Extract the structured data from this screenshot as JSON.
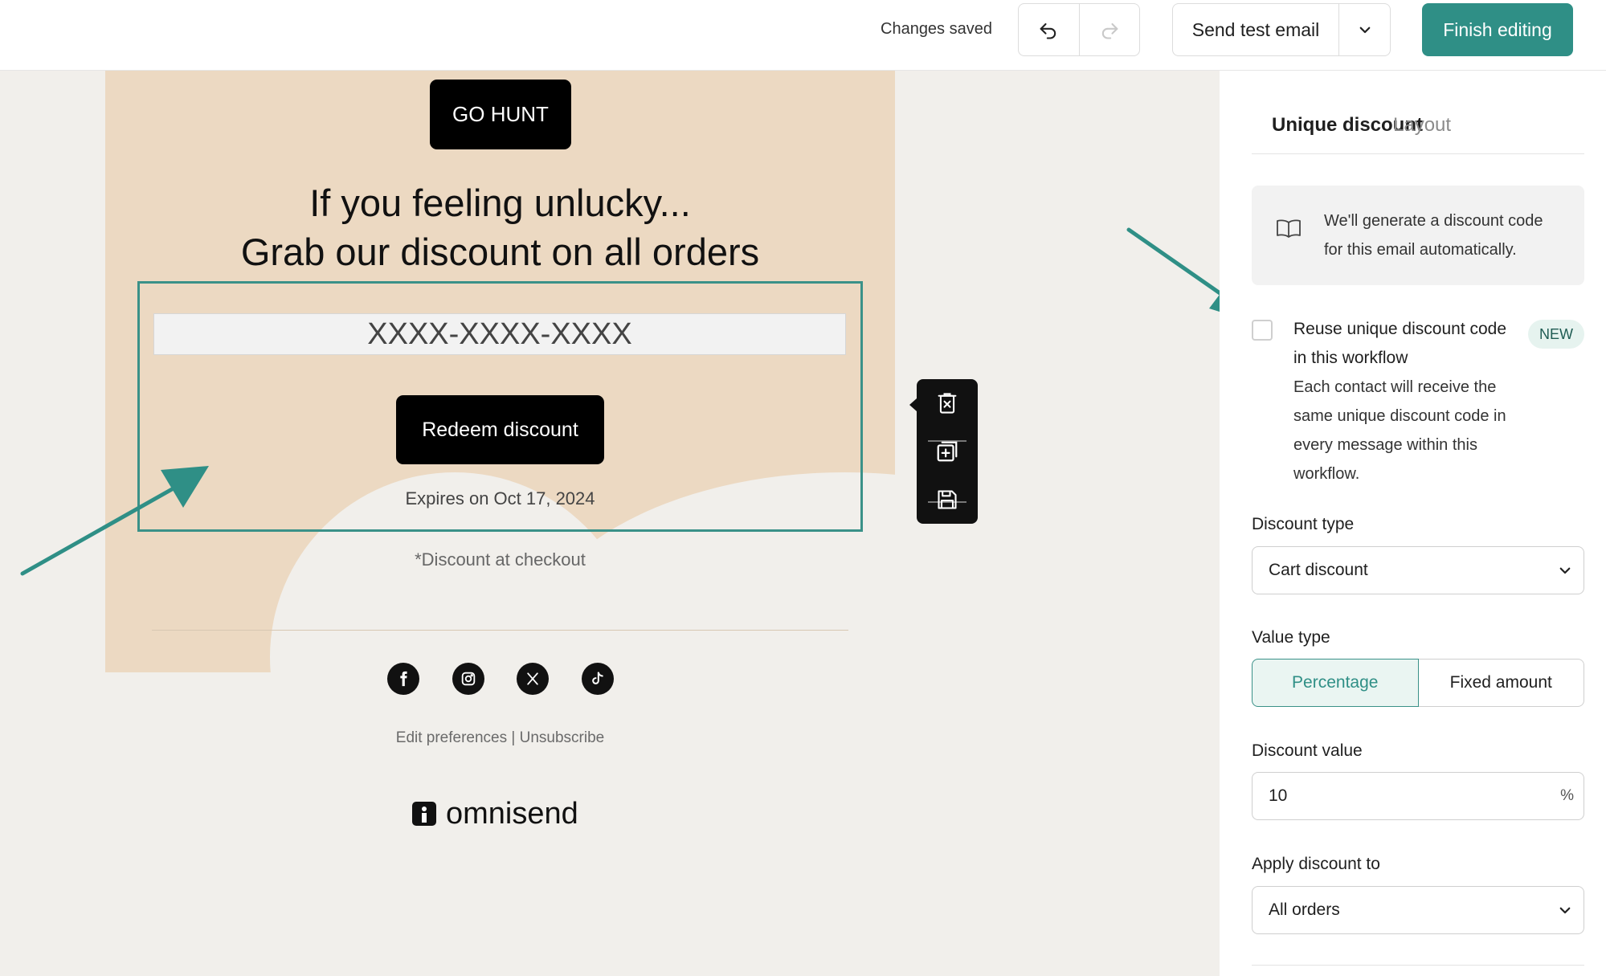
{
  "topbar": {
    "status": "Changes saved",
    "send_test_label": "Send test email",
    "finish_label": "Finish editing"
  },
  "email": {
    "cta_top": "GO HUNT",
    "headline_line1": "If you feeling unlucky...",
    "headline_line2": "Grab our discount on all orders",
    "discount_code": "XXXX-XXXX-XXXX",
    "redeem_label": "Redeem discount",
    "expires": "Expires on Oct 17, 2024",
    "footnote": "*Discount at checkout",
    "socials": [
      "facebook-icon",
      "instagram-icon",
      "x-icon",
      "tiktok-icon"
    ],
    "preferences": "Edit preferences | Unsubscribe",
    "brand": "omnisend"
  },
  "panel": {
    "tabs": [
      {
        "label": "Unique discount",
        "active": true
      },
      {
        "label": "Layout",
        "active": false
      }
    ],
    "info_text": "We'll generate a discount code for this email automatically.",
    "reuse_title": "Reuse unique discount code in this workflow",
    "reuse_badge": "NEW",
    "reuse_desc": "Each contact will receive the same unique discount code in every message within this workflow.",
    "discount_type_label": "Discount type",
    "discount_type_value": "Cart discount",
    "value_type_label": "Value type",
    "value_type_options": [
      "Percentage",
      "Fixed amount"
    ],
    "discount_value_label": "Discount value",
    "discount_value": "10",
    "discount_unit": "%",
    "apply_label": "Apply discount to",
    "apply_value": "All orders"
  },
  "colors": {
    "accent": "#2f8f86",
    "email_bg": "#ecd9c2",
    "canvas_bg": "#f1efeb"
  }
}
